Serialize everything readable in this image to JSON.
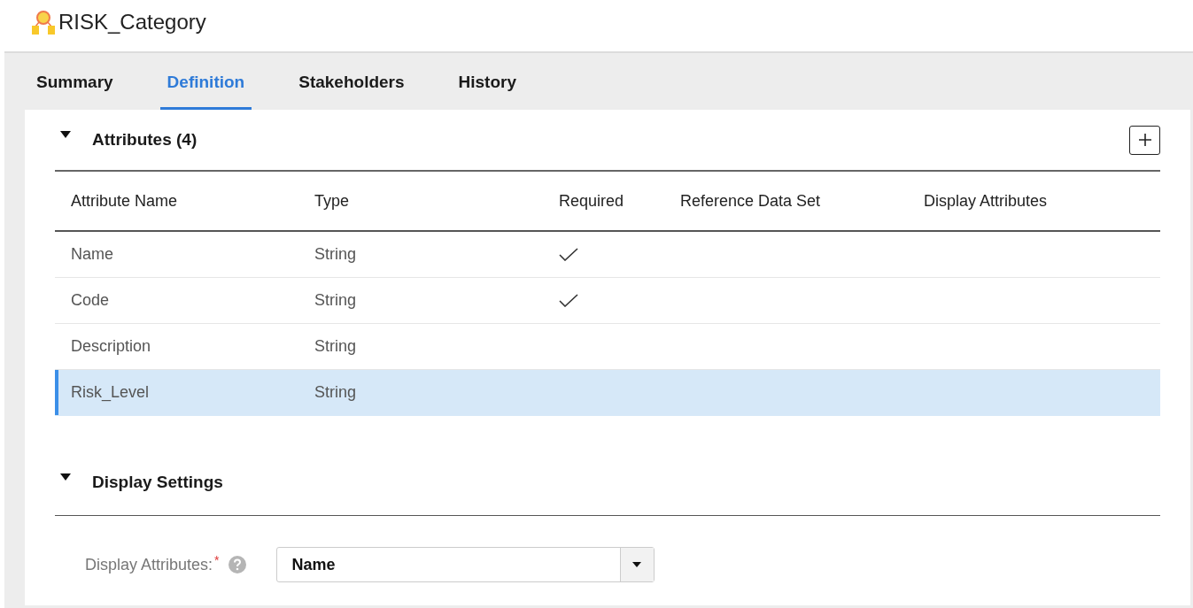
{
  "page": {
    "title": "RISK_Category"
  },
  "tabs": [
    {
      "label": "Summary",
      "selected": false
    },
    {
      "label": "Definition",
      "selected": true
    },
    {
      "label": "Stakeholders",
      "selected": false
    },
    {
      "label": "History",
      "selected": false
    }
  ],
  "attributes_section": {
    "title": "Attributes (4)",
    "expanded": true,
    "table": {
      "columns": [
        "Attribute Name",
        "Type",
        "Required",
        "Reference Data Set",
        "Display Attributes"
      ],
      "rows": [
        {
          "name": "Name",
          "type": "String",
          "required": true,
          "selected": false
        },
        {
          "name": "Code",
          "type": "String",
          "required": true,
          "selected": false
        },
        {
          "name": "Description",
          "type": "String",
          "required": false,
          "selected": false
        },
        {
          "name": "Risk_Level",
          "type": "String",
          "required": false,
          "selected": true
        }
      ]
    }
  },
  "display_settings": {
    "title": "Display Settings",
    "expanded": true,
    "field": {
      "label": "Display Attributes:",
      "required_mark": "*",
      "value": "Name"
    }
  }
}
